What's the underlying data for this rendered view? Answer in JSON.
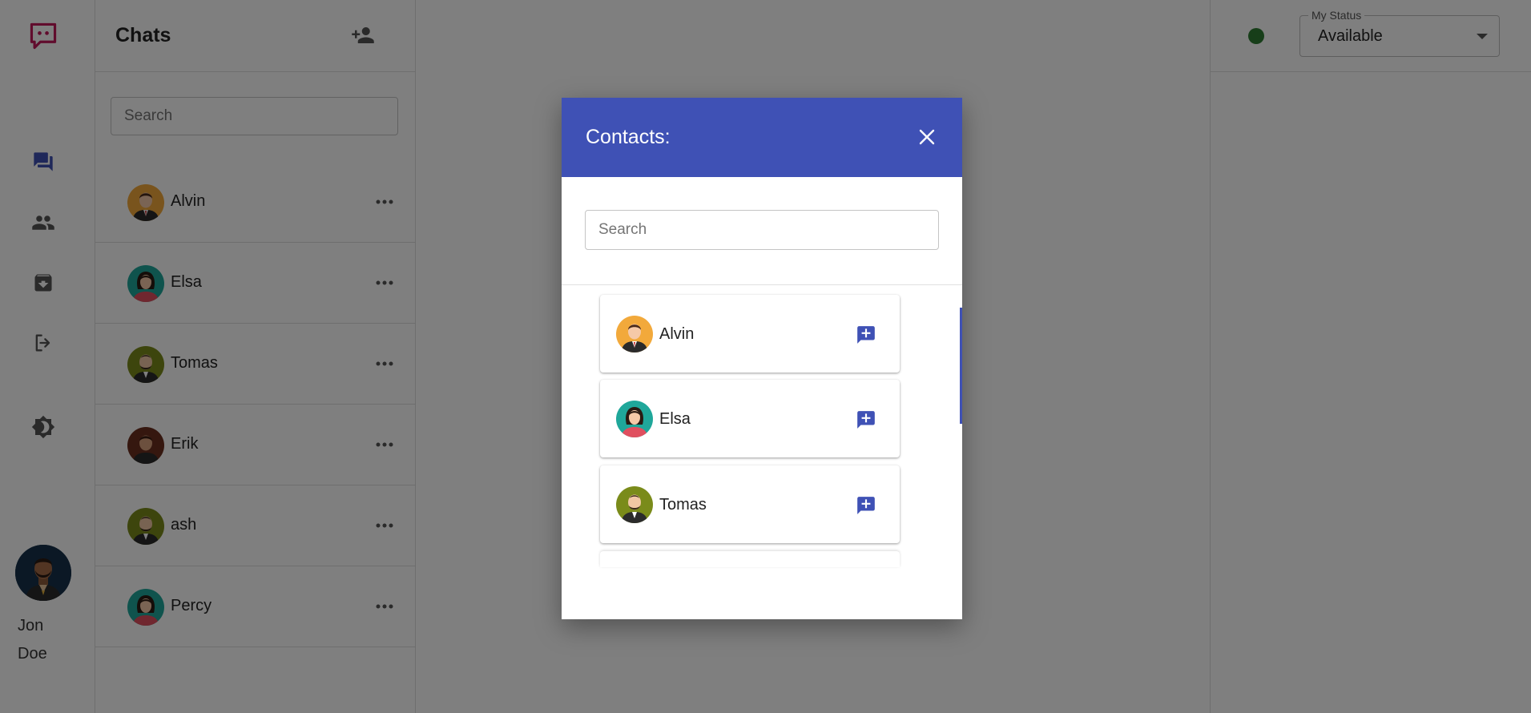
{
  "colors": {
    "brand": "#c2185b",
    "primary": "#3f51b5",
    "status_available": "#2e7d32"
  },
  "rail": {
    "logo_icon": "chat-bubble-logo",
    "items": [
      {
        "icon": "chats-icon",
        "active": true
      },
      {
        "icon": "contacts-icon",
        "active": false
      },
      {
        "icon": "archive-icon",
        "active": false
      },
      {
        "icon": "logout-icon",
        "active": false
      },
      {
        "icon": "brightness-icon",
        "active": false
      }
    ],
    "user": {
      "first": "Jon",
      "last": "Doe"
    }
  },
  "chats": {
    "title": "Chats",
    "search_placeholder": "Search",
    "items": [
      {
        "name": "Alvin"
      },
      {
        "name": "Elsa"
      },
      {
        "name": "Tomas"
      },
      {
        "name": "Erik"
      },
      {
        "name": "ash"
      },
      {
        "name": "Percy"
      }
    ]
  },
  "status": {
    "label": "My Status",
    "value": "Available"
  },
  "dialog": {
    "title": "Contacts:",
    "search_placeholder": "Search",
    "contacts": [
      {
        "name": "Alvin"
      },
      {
        "name": "Elsa"
      },
      {
        "name": "Tomas"
      }
    ]
  }
}
